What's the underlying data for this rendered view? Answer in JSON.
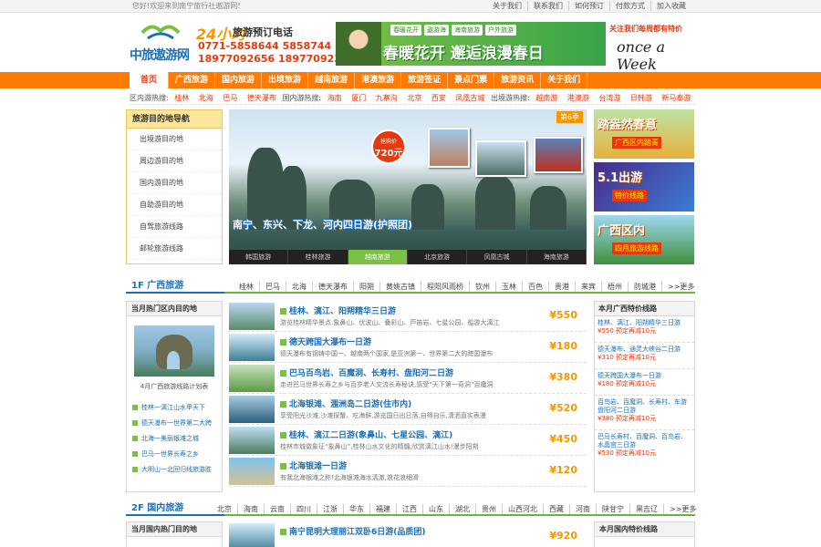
{
  "topbar": {
    "welcome": "您好!欢迎来到南宁旅行社遨游网!",
    "links": [
      "关于我们",
      "联系我们",
      "如何预订",
      "付款方式",
      "加入收藏"
    ]
  },
  "header": {
    "logo_text": "中旅遨游网",
    "phone_24": "24小时",
    "phone_title": "旅游预订电话",
    "phone_line1": "0771-5858644 5858744",
    "phone_line2": "18977092656 18977092386",
    "banner_tags": [
      "春暖花开",
      "遨游海",
      "海南旅游",
      "户外旅游"
    ],
    "banner_text": "春暖花开 邂逅浪漫春日",
    "promo_text": "关注我们每周都有特价",
    "promo_week": "once a Week"
  },
  "nav": {
    "items": [
      "首页",
      "广西旅游",
      "国内旅游",
      "出境旅游",
      "越南旅游",
      "港澳旅游",
      "旅游签证",
      "景点门票",
      "旅游资讯",
      "关于我们"
    ]
  },
  "hotbar": {
    "label1": "区内游热搜:",
    "items1": [
      "桂林",
      "北海",
      "巴马",
      "德天瀑布"
    ],
    "label2": "国内游热搜:",
    "items2": [
      "海南",
      "厦门",
      "九寨沟",
      "北京",
      "西安",
      "凤凰古城"
    ],
    "label3": "出境游热搜:",
    "items3": [
      "越南游",
      "港澳游",
      "台湾游",
      "日韩游",
      "新马泰游"
    ]
  },
  "leftnav": {
    "title": "旅游目的地导航",
    "items": [
      "出境游目的地",
      "周边游目的地",
      "国内游目的地",
      "自助游目的地",
      "自驾旅游线路",
      "邮轮旅游线路"
    ]
  },
  "slider": {
    "price_label": "抢购价",
    "price_value": "720元",
    "tag": "第6季",
    "caption": "南宁、东兴、下龙、河内四日游(护照团)",
    "tabs": [
      "韩国旅游",
      "桂林旅游",
      "越南旅游",
      "北京旅游",
      "凤凰古城",
      "海南旅游"
    ],
    "active_tab": 2
  },
  "right_ads": [
    {
      "title": "踏盎然春意",
      "sub": "广西区内踏青"
    },
    {
      "title": "5.1出游",
      "sub": "特价线路"
    },
    {
      "title": "广西区内",
      "sub": "四月旅游线路"
    }
  ],
  "section1": {
    "title": "1F 广西旅游",
    "cities": [
      "桂林",
      "巴马",
      "北海",
      "德天瀑布",
      "阳朔",
      "黄姚古镇",
      "程阳风雨桥",
      "钦州",
      "玉林",
      "百色",
      "贵港",
      "来宾",
      "梧州",
      "防城港",
      ">>更多"
    ],
    "left_title": "当月热门区内目的地",
    "left_caption": "4月广西旅游线路计划表",
    "left_links": [
      "桂林一漓江山水甲天下",
      "德天瀑布一世界第二大跨",
      "北海一美丽银滩之城",
      "巴马一世界长寿之乡",
      "大明山一北回归线旅游胜"
    ],
    "routes": [
      {
        "title": "桂林、漓江、阳朔精华三日游",
        "desc": "游览桂林精华景点:象鼻山、伏波山、叠彩山、芦笛岩、七星公园、船游大漓江",
        "price": "¥550"
      },
      {
        "title": "德天跨国大瀑布一日游",
        "desc": "德天瀑布有钢铸中国一、越南两个国家,是亚洲第一、世界第二大的跨国瀑布",
        "price": "¥180"
      },
      {
        "title": "巴马百鸟岩、百魔洞、长寿村、盘阳河二日游",
        "desc": "走进巴马世界长寿之乡与百岁老人交流长寿秘诀,感受“天下第一奇洞”百魔洞",
        "price": "¥380"
      },
      {
        "title": "北海银滩、涠洲岛二日游(住市内)",
        "desc": "享受阳光沙滩,沙滩探蟹、吃海鲜,游览国日出日落,自得自乐,潇洒直实表漫",
        "price": "¥520"
      },
      {
        "title": "桂林、漓江二日游(象鼻山、七星公园、漓江)",
        "desc": "桂林市城徽象征“象鼻山”,桂林山水文化的精髓;欣赏漓江山水!漫步阳朔",
        "price": "¥450"
      },
      {
        "title": "北海银滩一日游",
        "desc": "有我北海银滩之称!北海银滩海水清澈,浪花浪细滑",
        "price": "¥120"
      }
    ],
    "special_title": "本月广西特价线路",
    "specials": [
      {
        "name": "桂林、漓江、阳朔精华三日游",
        "price": "¥550 预定再减10元"
      },
      {
        "name": "德天瀑布、通灵大峡谷二日游",
        "price": "¥310 预定再减10元"
      },
      {
        "name": "德天跨国大瀑布一日游",
        "price": "¥180 预定再减10元"
      },
      {
        "name": "百鸟岩、百魔洞、长寿村、车游盘阳河二日游",
        "price": "¥380 预定再减10元"
      },
      {
        "name": "巴马长寿村、百魔洞、百鸟岩、水晶宫三日游",
        "price": "¥530 预定再减10元"
      }
    ]
  },
  "section2": {
    "title": "2F 国内旅游",
    "cities": [
      "北京",
      "海南",
      "云南",
      "四川",
      "江浙",
      "华东",
      "福建",
      "江西",
      "山东",
      "湖北",
      "贵州",
      "山西河北",
      "西藏",
      "河南",
      "陕甘宁",
      "黑吉辽",
      ">>更多"
    ],
    "left_title": "当月国内热门目的地",
    "route": {
      "title": "南宁昆明大理丽江双卧6日游(品质团)",
      "price": "¥920"
    },
    "special_title": "本月国内特价线路"
  }
}
